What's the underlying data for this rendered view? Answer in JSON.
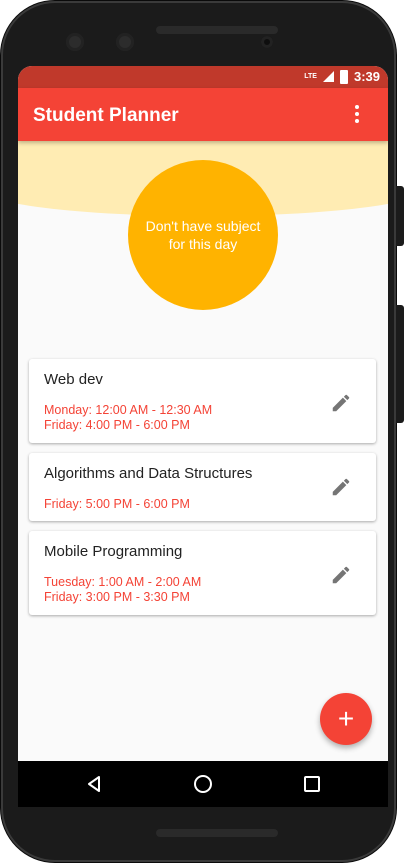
{
  "status_bar": {
    "network_label": "LTE",
    "time": "3:39"
  },
  "app_bar": {
    "title": "Student Planner",
    "menu_icon": "more-vertical-icon"
  },
  "empty_state": {
    "message": "Don't have subject for this day",
    "circle_color": "#ffb300",
    "band_color": "#ffecb3"
  },
  "subjects": [
    {
      "name": "Web dev",
      "times": [
        "Monday: 12:00 AM - 12:30 AM",
        "Friday: 4:00 PM - 6:00 PM"
      ]
    },
    {
      "name": "Algorithms and Data Structures",
      "times": [
        "Friday: 5:00 PM - 6:00 PM"
      ]
    },
    {
      "name": "Mobile Programming",
      "times": [
        "Tuesday: 1:00 AM - 2:00 AM",
        "Friday: 3:00 PM - 3:30 PM"
      ]
    }
  ],
  "fab": {
    "label": "+",
    "icon": "add-icon"
  },
  "nav_bar": {
    "icons": [
      "back-icon",
      "home-icon",
      "recents-icon"
    ]
  },
  "colors": {
    "primary": "#f44336",
    "primary_dark": "#c0392b",
    "accent": "#ffb300"
  }
}
